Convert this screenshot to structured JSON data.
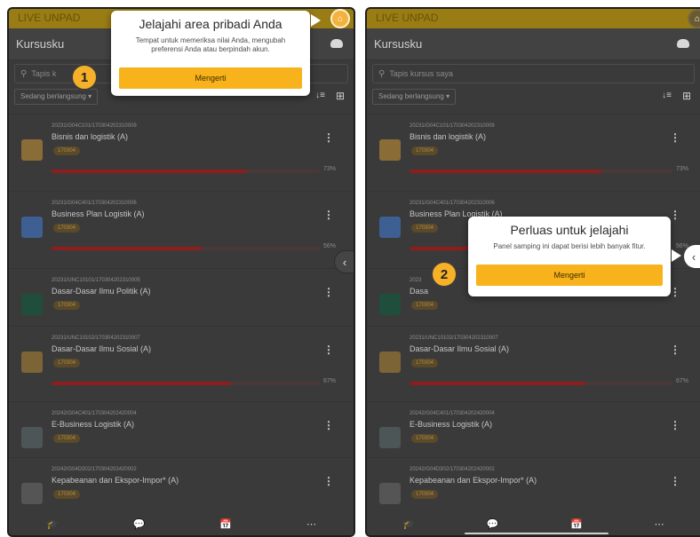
{
  "screen1": {
    "app_title": "LIVE UNPAD",
    "page_title": "Kursusku",
    "search_placeholder": "Tapis k",
    "filter_label": "Sedang berlangsung",
    "tour": {
      "step": "1",
      "title": "Jelajahi area pribadi Anda",
      "body": "Tempat untuk memeriksa nilai Anda, mengubah preferensi Anda atau berpindah akun.",
      "button": "Mengerti"
    },
    "courses": [
      {
        "code": "20231/G04C101/170304202310009",
        "name": "Bisnis dan logistik (A)",
        "badge": "170304",
        "progress": 73,
        "progress_label": "73%",
        "color": "#8a6d36"
      },
      {
        "code": "20231/G04C401/170304202310006",
        "name": "Business Plan Logistik (A)",
        "badge": "170304",
        "progress": 56,
        "progress_label": "56%",
        "color": "#3d5f92"
      },
      {
        "code": "20231/UNC10101/170304202310005",
        "name": "Dasar-Dasar Ilmu Politik (A)",
        "badge": "170304",
        "progress": null,
        "progress_label": "",
        "color": "#1f4e3c"
      },
      {
        "code": "20231/UNC10102/170304202310007",
        "name": "Dasar-Dasar Ilmu Sosial (A)",
        "badge": "170304",
        "progress": 67,
        "progress_label": "67%",
        "color": "#7d6436"
      },
      {
        "code": "20242/G04C401/170304202420004",
        "name": "E-Business Logistik (A)",
        "badge": "170304",
        "progress": null,
        "progress_label": "",
        "color": "#4c5656"
      },
      {
        "code": "20242/G04D302/170304202420002",
        "name": "Kepabeanan dan Ekspor-Impor* (A)",
        "badge": "170304",
        "progress": null,
        "progress_label": "",
        "color": "#555555"
      }
    ]
  },
  "screen2": {
    "app_title": "LIVE UNPAD",
    "page_title": "Kursusku",
    "search_placeholder": "Tapis kursus saya",
    "filter_label": "Sedang berlangsung",
    "tour": {
      "step": "2",
      "title": "Perluas untuk jelajahi",
      "body": "Panel samping ini dapat berisi lebih banyak fitur.",
      "button": "Mengerti"
    },
    "courses": [
      {
        "code": "20231/G04C101/170304202310009",
        "name": "Bisnis dan logistik (A)",
        "badge": "170304",
        "progress": 73,
        "progress_label": "73%",
        "color": "#8a6d36"
      },
      {
        "code": "20231/G04C401/170304202310006",
        "name": "Business Plan Logistik (A)",
        "badge": "170304",
        "progress": 56,
        "progress_label": "56%",
        "color": "#3d5f92"
      },
      {
        "code": "2023",
        "name": "Dasa",
        "badge": "170304",
        "progress": null,
        "progress_label": "",
        "color": "#1f4e3c"
      },
      {
        "code": "20231/UNC10102/170304202310007",
        "name": "Dasar-Dasar Ilmu Sosial (A)",
        "badge": "170304",
        "progress": 67,
        "progress_label": "67%",
        "color": "#7d6436"
      },
      {
        "code": "20242/G04C401/170304202420004",
        "name": "E-Business Logistik (A)",
        "badge": "170304",
        "progress": null,
        "progress_label": "",
        "color": "#4c5656"
      },
      {
        "code": "20242/G04D302/170304202420002",
        "name": "Kepabeanan dan Ekspor-Impor* (A)",
        "badge": "170304",
        "progress": null,
        "progress_label": "",
        "color": "#555555"
      }
    ]
  },
  "icons": {
    "home": "⌂",
    "search": "⚲",
    "sort": "↓≡",
    "grid": "⊞",
    "kebab": "⋮",
    "dropdown": "▾",
    "chevron_left": "‹",
    "nav": [
      "🎓",
      "💬",
      "📅",
      "⋯"
    ]
  },
  "colors": {
    "brand": "#f7b21c",
    "progress": "#8e1d1d",
    "topbar": "#9a7c14"
  }
}
